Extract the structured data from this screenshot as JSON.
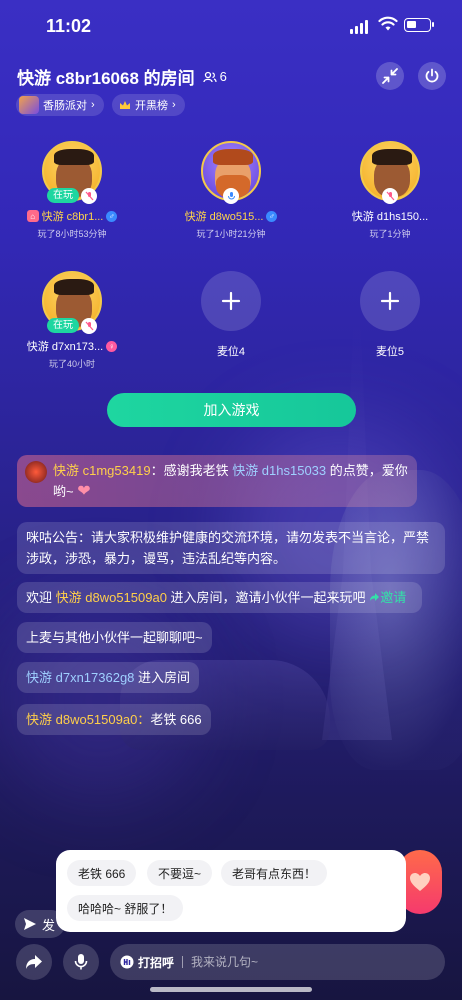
{
  "status": {
    "time": "11:02"
  },
  "header": {
    "title": "快游 c8br16068 的房间",
    "online_count": "6",
    "tags": [
      "香肠派对",
      "开黑榜"
    ]
  },
  "seats": [
    {
      "name": "快游 c8br1...",
      "badge": "在玩",
      "gender": "male",
      "playtime": "玩了8小时53分钟",
      "avatar": "boy"
    },
    {
      "name": "快游 d8wo515...",
      "badge": "",
      "gender": "male",
      "playtime": "玩了1小时21分钟",
      "avatar": "beard"
    },
    {
      "name": "快游 d1hs150...",
      "badge": "",
      "gender": "",
      "playtime": "玩了1分钟",
      "avatar": "boy"
    },
    {
      "name": "快游 d7xn173...",
      "badge": "在玩",
      "gender": "female",
      "playtime": "玩了40小时",
      "avatar": "boy"
    },
    {
      "name": "麦位4",
      "empty": true
    },
    {
      "name": "麦位5",
      "empty": true
    }
  ],
  "join_button": "加入游戏",
  "chat": {
    "thanks": {
      "nick": "快游 c1mg53419",
      "text1": "：感谢我老铁 ",
      "target": "快游 d1hs15033",
      "text2": " 的点赞，爱你哟~"
    },
    "notice": "咪咕公告：请大家积极维护健康的交流环境，请勿发表不当言论，严禁涉政，涉恐，暴力，谩骂，违法乱纪等内容。",
    "welcome": {
      "prefix": "欢迎 ",
      "nick": "快游 d8wo51509a0",
      "text": " 进入房间，邀请小伙伴一起来玩吧",
      "action": "邀请"
    },
    "mic_tip": "上麦与其他小伙伴一起聊聊吧~",
    "enter": {
      "nick": "快游 d7xn17362g8",
      "text": " 进入房间"
    },
    "last": {
      "nick": "快游 d8wo51509a0：",
      "text": "老铁 666"
    }
  },
  "quick_replies": [
    "老铁 666",
    "不要逗~",
    "老哥有点东西！",
    "哈哈哈~ 舒服了！"
  ],
  "share_label": "发",
  "input": {
    "greet": "打招呼",
    "placeholder": "我来说几句~"
  }
}
